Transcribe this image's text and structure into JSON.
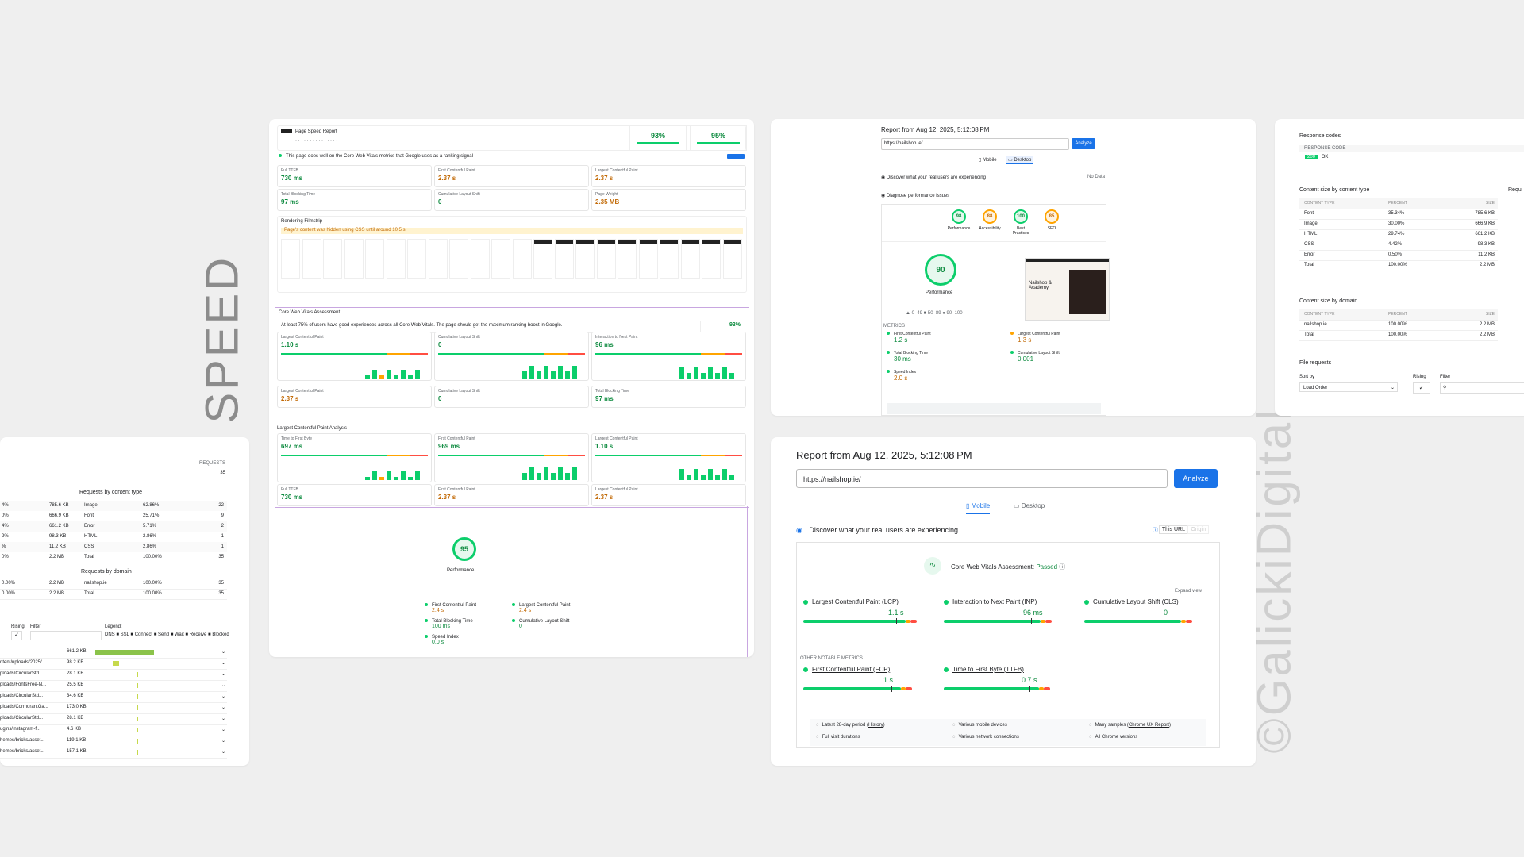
{
  "brand": {
    "vertical_word": "SPEED",
    "watermark": "©GalickiDigital"
  },
  "colors": {
    "good": "#0cce6b",
    "average": "#ffa400",
    "poor": "#ff4e42",
    "accent": "#1a73e8",
    "background": "#efefef"
  },
  "left_card": {
    "requests_header": "REQUESTS",
    "requests_total_top": "35",
    "content_title": "Requests by content type",
    "content_rows": [
      {
        "pct_left": "4%",
        "size_left": "785.6 KB",
        "type": "Image",
        "percent": "62.86%",
        "requests": "22"
      },
      {
        "pct_left": "0%",
        "size_left": "666.9 KB",
        "type": "Font",
        "percent": "25.71%",
        "requests": "9"
      },
      {
        "pct_left": "4%",
        "size_left": "661.2 KB",
        "type": "Error",
        "percent": "5.71%",
        "requests": "2"
      },
      {
        "pct_left": "2%",
        "size_left": "98.3 KB",
        "type": "HTML",
        "percent": "2.86%",
        "requests": "1"
      },
      {
        "pct_left": "%",
        "size_left": "11.2 KB",
        "type": "CSS",
        "percent": "2.86%",
        "requests": "1"
      },
      {
        "pct_left": "0%",
        "size_left": "2.2 MB",
        "type": "Total",
        "percent": "100.00%",
        "requests": "35"
      }
    ],
    "domain_title": "Requests by domain",
    "domain_rows": [
      {
        "pct_left": "0.00%",
        "size_left": "2.2 MB",
        "domain": "nailshop.ie",
        "percent": "100.00%",
        "requests": "35"
      },
      {
        "pct_left": "0.00%",
        "size_left": "2.2 MB",
        "domain": "Total",
        "percent": "100.00%",
        "requests": "35"
      }
    ],
    "rising_label": "Rising",
    "filter_label": "Filter",
    "legend_label": "Legend:",
    "legend_items": "DNS ■ SSL ■ Connect ■ Send ■ Wait ■ Receive ■ Blocked",
    "file_rows": [
      {
        "name": "",
        "size": "661.2 KB"
      },
      {
        "name": "ntent/uploads/2025/...",
        "size": "98.2 KB"
      },
      {
        "name": "ploads/CircularStd...",
        "size": "28.1 KB"
      },
      {
        "name": "ploads/FontsFree-N...",
        "size": "25.5 KB"
      },
      {
        "name": "ploads/CircularStd...",
        "size": "34.6 KB"
      },
      {
        "name": "ploads/CormorantGa...",
        "size": "173.0 KB"
      },
      {
        "name": "ploads/CircularStd...",
        "size": "28.1 KB"
      },
      {
        "name": "ugins/instagram-f...",
        "size": "4.6 KB"
      },
      {
        "name": "hemes/bricks/asset...",
        "size": "119.1 KB"
      },
      {
        "name": "hemes/bricks/asset...",
        "size": "157.1 KB"
      }
    ]
  },
  "middle_card": {
    "title": "Page Speed Report",
    "score_a": "93%",
    "score_b": "95%",
    "banner": "This page does well on the Core Web Vitals metrics that Google uses as a ranking signal",
    "metrics_top": [
      {
        "label": "Full TTFB",
        "value": "730 ms"
      },
      {
        "label": "First Contentful Paint",
        "value": "2.37 s"
      },
      {
        "label": "Largest Contentful Paint",
        "value": "2.37 s"
      },
      {
        "label": "Total Blocking Time",
        "value": "97 ms"
      },
      {
        "label": "Cumulative Layout Shift",
        "value": "0"
      },
      {
        "label": "Page Weight",
        "value": "2.35 MB"
      }
    ],
    "rendering_title": "Rendering Filmstrip",
    "rendering_note": "Page's content was hidden using CSS until around 10.5 s",
    "cwv_title": "Core Web Vitals Assessment",
    "cwv_note": "At least 75% of users have good experiences across all Core Web Vitals. The page should get the maximum ranking boost in Google.",
    "cwv_pct": "93%",
    "cwv_metrics": [
      {
        "label": "Largest Contentful Paint",
        "value": "1.10 s"
      },
      {
        "label": "Cumulative Layout Shift",
        "value": "0"
      },
      {
        "label": "Interaction to Next Paint",
        "value": "96 ms"
      }
    ],
    "cwv_lab": [
      {
        "label": "Largest Contentful Paint",
        "value": "2.37 s"
      },
      {
        "label": "Cumulative Layout Shift",
        "value": "0"
      },
      {
        "label": "Total Blocking Time",
        "value": "97 ms"
      }
    ],
    "lcp_title": "Largest Contentful Paint Analysis",
    "lcp_metrics": [
      {
        "label": "Time to First Byte",
        "value": "697 ms"
      },
      {
        "label": "First Contentful Paint",
        "value": "969 ms"
      },
      {
        "label": "Largest Contentful Paint",
        "value": "1.10 s"
      }
    ],
    "lcp_lab": [
      {
        "label": "Full TTFB",
        "value": "730 ms"
      },
      {
        "label": "First Contentful Paint",
        "value": "2.37 s"
      },
      {
        "label": "Largest Contentful Paint",
        "value": "2.37 s"
      }
    ],
    "perf_score": "95",
    "perf_label": "Performance",
    "bottom_metrics": [
      {
        "label": "First Contentful Paint",
        "value": "2.4 s"
      },
      {
        "label": "Largest Contentful Paint",
        "value": "2.4 s"
      },
      {
        "label": "Total Blocking Time",
        "value": "100 ms"
      },
      {
        "label": "Cumulative Layout Shift",
        "value": "0"
      },
      {
        "label": "Speed Index",
        "value": "0.0 s"
      }
    ]
  },
  "desktop_card": {
    "report_title": "Report from Aug 12, 2025, 5:12:08 PM",
    "url": "https://nailshop.ie/",
    "analyze": "Analyze",
    "tab_mobile": "Mobile",
    "tab_desktop": "Desktop",
    "discover": "Discover what your real users are experiencing",
    "no_data": "No Data",
    "diagnose": "Diagnose performance issues",
    "scores": [
      {
        "value": "98",
        "label": "Performance"
      },
      {
        "value": "88",
        "label": "Accessibility"
      },
      {
        "value": "100",
        "label": "Best Practices"
      },
      {
        "value": "85",
        "label": "SEO"
      }
    ],
    "perf_big": "90",
    "perf_label": "Performance",
    "shop_name": "Nailshop & Academy",
    "metrics": [
      {
        "label": "First Contentful Paint",
        "value": "1.2 s"
      },
      {
        "label": "Largest Contentful Paint",
        "value": "1.3 s"
      },
      {
        "label": "Total Blocking Time",
        "value": "30 ms"
      },
      {
        "label": "Cumulative Layout Shift",
        "value": "0.001"
      },
      {
        "label": "Speed Index",
        "value": "2.0 s"
      }
    ]
  },
  "mobile_card": {
    "report_title": "Report from Aug 12, 2025, 5:12:08 PM",
    "url": "https://nailshop.ie/",
    "analyze": "Analyze",
    "tab_mobile": "Mobile",
    "tab_desktop": "Desktop",
    "discover": "Discover what your real users are experiencing",
    "this_url": "This URL",
    "origin": "Origin",
    "cwv_label": "Core Web Vitals Assessment:",
    "cwv_status": "Passed",
    "expand": "Expand view",
    "metrics": [
      {
        "label": "Largest Contentful Paint (LCP)",
        "value": "1.1 s",
        "marker": 0.78
      },
      {
        "label": "Interaction to Next Paint (INP)",
        "value": "96 ms",
        "marker": 0.73
      },
      {
        "label": "Cumulative Layout Shift (CLS)",
        "value": "0",
        "marker": 0.73
      }
    ],
    "other_title": "OTHER NOTABLE METRICS",
    "other_metrics": [
      {
        "label": "First Contentful Paint (FCP)",
        "value": "1 s",
        "marker": 0.74
      },
      {
        "label": "Time to First Byte (TTFB)",
        "value": "0.7 s",
        "marker": 0.72
      }
    ],
    "footer": [
      {
        "icon": "calendar-icon",
        "text": "Latest 28-day period",
        "link": "History"
      },
      {
        "icon": "devices-icon",
        "text": "Various mobile devices",
        "link": ""
      },
      {
        "icon": "people-icon",
        "text": "Many samples",
        "link": "Chrome UX Report"
      },
      {
        "icon": "timer-icon",
        "text": "Full visit durations",
        "link": ""
      },
      {
        "icon": "wifi-icon",
        "text": "Various network connections",
        "link": ""
      },
      {
        "icon": "chrome-icon",
        "text": "All Chrome versions",
        "link": ""
      }
    ]
  },
  "right_card": {
    "response_title": "Response codes",
    "response_col": "RESPONSE CODE",
    "response_code": "200",
    "response_text": "OK",
    "content_title": "Content size by content type",
    "req_title_cut": "Requ",
    "headers": [
      "CONTENT TYPE",
      "PERCENT",
      "SIZE"
    ],
    "content_rows": [
      {
        "type": "Font",
        "percent": "35.34%",
        "size": "785.6 KB"
      },
      {
        "type": "Image",
        "percent": "30.00%",
        "size": "666.9 KB"
      },
      {
        "type": "HTML",
        "percent": "29.74%",
        "size": "661.2 KB"
      },
      {
        "type": "CSS",
        "percent": "4.42%",
        "size": "98.3 KB"
      },
      {
        "type": "Error",
        "percent": "0.50%",
        "size": "11.2 KB"
      },
      {
        "type": "Total",
        "percent": "100.00%",
        "size": "2.2 MB"
      }
    ],
    "domain_title": "Content size by domain",
    "domain_rows": [
      {
        "type": "nailshop.ie",
        "percent": "100.00%",
        "size": "2.2 MB"
      },
      {
        "type": "Total",
        "percent": "100.00%",
        "size": "2.2 MB"
      }
    ],
    "file_title": "File requests",
    "sort_label": "Sort by",
    "sort_value": "Load Order",
    "rising_label": "Rising",
    "filter_label": "Filter"
  }
}
